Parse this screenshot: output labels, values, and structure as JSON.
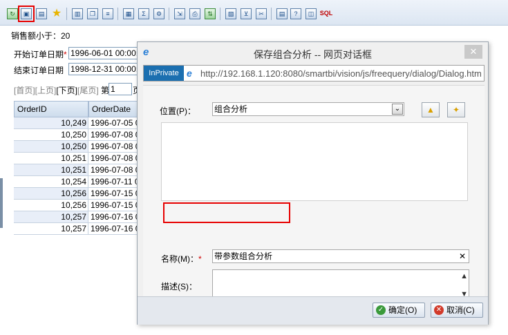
{
  "toolbar": {
    "sql_label": "SQL"
  },
  "page": {
    "sales_filter_label": "销售额小于：20",
    "start_date_label": "开始订单日期",
    "start_date_required": "*",
    "start_date_value": "1996-06-01 00:00:",
    "end_date_label": "结束订单日期",
    "end_date_value": "1998-12-31 00:00:",
    "pager": {
      "first": "[首页]",
      "prev": "[上页]",
      "next": "[下页]",
      "last": "[尾页]",
      "page_prefix": "第",
      "page_value": "1",
      "page_suffix": "页"
    },
    "grid": {
      "columns": [
        "OrderID",
        "OrderDate"
      ],
      "rows": [
        [
          "10,249",
          "1996-07-05 0"
        ],
        [
          "10,250",
          "1996-07-08 0"
        ],
        [
          "10,250",
          "1996-07-08 0"
        ],
        [
          "10,251",
          "1996-07-08 0"
        ],
        [
          "10,251",
          "1996-07-08 0"
        ],
        [
          "10,254",
          "1996-07-11 0"
        ],
        [
          "10,256",
          "1996-07-15 0"
        ],
        [
          "10,256",
          "1996-07-15 0"
        ],
        [
          "10,257",
          "1996-07-16 0"
        ],
        [
          "10,257",
          "1996-07-16 0"
        ]
      ]
    }
  },
  "dialog": {
    "title": "保存组合分析 -- 网页对话框",
    "close_glyph": "✕",
    "inprivate": "InPrivate",
    "url": "http://192.168.1.120:8080/smartbi/vision/js/freequery/dialog/Dialog.htm",
    "location_label": "位置(P)：",
    "location_value": "组合分析",
    "name_label": "名称(M)：",
    "name_required": "*",
    "name_value": "带参数组合分析",
    "name_clear": "✕",
    "desc_label": "描述(S)：",
    "ok_label": "确定(O)",
    "cancel_label": "取消(C)"
  },
  "colors": {
    "highlight": "#e60000",
    "inprivate_bg": "#1b6fb0"
  }
}
